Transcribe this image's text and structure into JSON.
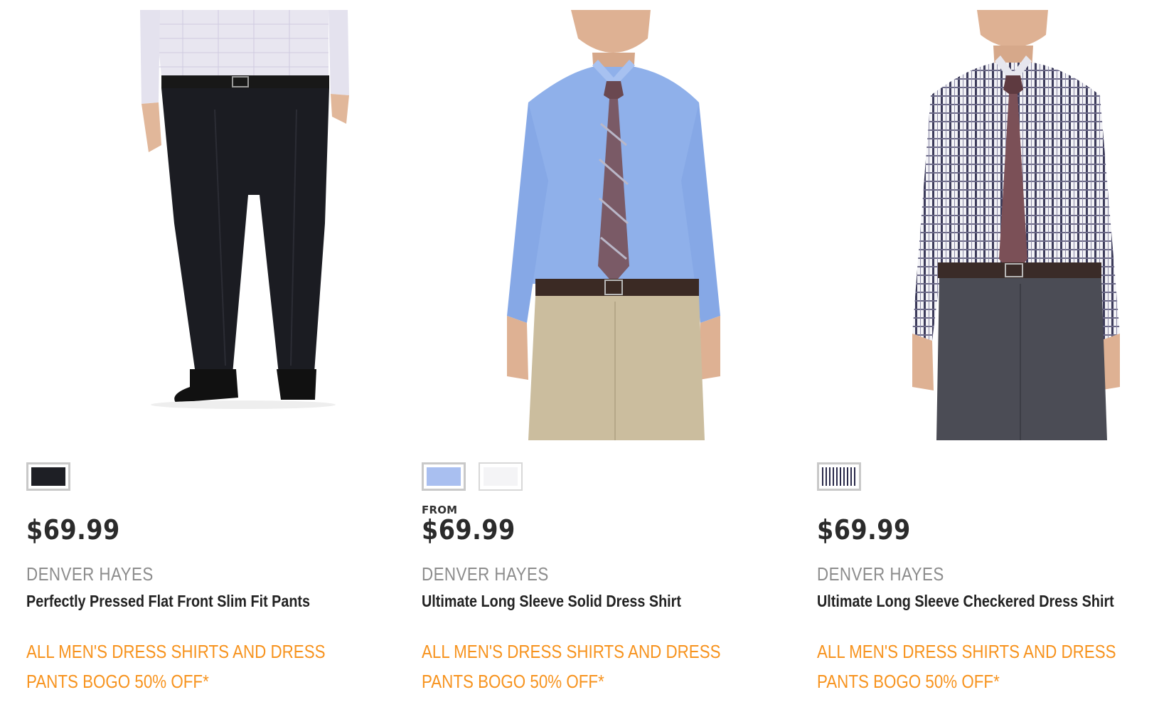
{
  "products": [
    {
      "image_alt": "Perfectly Pressed Flat Front Slim Fit Pants",
      "swatches": [
        {
          "color": "black",
          "hex": "#1e1f25"
        }
      ],
      "from_label": "",
      "price": "$69.99",
      "brand": "DENVER HAYES",
      "name": "Perfectly Pressed Flat Front Slim Fit Pants",
      "promo_line1": "ALL MEN'S DRESS SHIRTS AND DRESS",
      "promo_line2": "PANTS BOGO 50% OFF*"
    },
    {
      "image_alt": "Ultimate Long Sleeve Solid Dress Shirt",
      "swatches": [
        {
          "color": "light-blue",
          "hex": "#a9bff0"
        },
        {
          "color": "white",
          "hex": "#f4f4f6"
        }
      ],
      "from_label": "FROM",
      "price": "$69.99",
      "brand": "DENVER HAYES",
      "name": "Ultimate Long Sleeve Solid Dress Shirt",
      "promo_line1": "ALL MEN'S DRESS SHIRTS AND DRESS",
      "promo_line2": "PANTS BOGO 50% OFF*"
    },
    {
      "image_alt": "Ultimate Long Sleeve Checkered Dress Shirt",
      "swatches": [
        {
          "color": "checkered-navy",
          "hex": "#2a2a4a"
        }
      ],
      "from_label": "",
      "price": "$69.99",
      "brand": "DENVER HAYES",
      "name": "Ultimate Long Sleeve Checkered Dress Shirt",
      "promo_line1": "ALL MEN'S DRESS SHIRTS AND DRESS",
      "promo_line2": "PANTS BOGO 50% OFF*"
    }
  ],
  "colors": {
    "promo": "#f7931e",
    "brand": "#8c8c8c",
    "price": "#2b2b2b",
    "name": "#222222"
  }
}
